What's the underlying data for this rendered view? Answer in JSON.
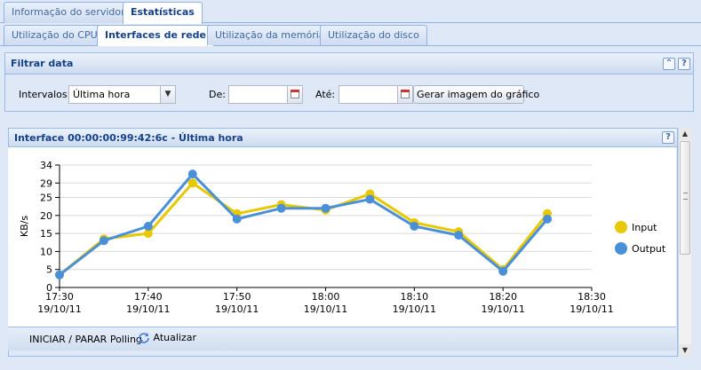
{
  "tabs": [
    {
      "label": "Informação do servidor",
      "active": false
    },
    {
      "label": "Estatísticas",
      "active": true
    }
  ],
  "subtabs": [
    {
      "label": "Utilização do CPU",
      "active": false
    },
    {
      "label": "Interfaces de rede",
      "active": true
    },
    {
      "label": "Utilização da memória",
      "active": false
    },
    {
      "label": "Utilização do disco",
      "active": false
    }
  ],
  "filter": {
    "title": "Filtrar data",
    "collapse_icon": "double-chevron-up-icon",
    "help_icon": "question-icon",
    "interval_label": "Intervalos:",
    "interval_value": "Última hora",
    "from_label": "De:",
    "from_value": "",
    "to_label": "Até:",
    "to_value": "",
    "generate_button": "Gerar imagem do gráfico"
  },
  "graph_panel": {
    "title": "Interface 00:00:00:99:42:6c - Última hora",
    "help_icon": "question-icon"
  },
  "toolbar": {
    "polling_label": "INICIAR / PARAR Polling",
    "refresh_label": "Atualizar",
    "refresh_icon": "refresh-icon"
  },
  "chart_data": {
    "type": "line",
    "ylabel": "KB/s",
    "xlabel": "",
    "ylim": [
      0,
      34
    ],
    "yticks": [
      0,
      5,
      10,
      15,
      20,
      25,
      29,
      34
    ],
    "xticks": [
      {
        "time": "17:30",
        "date": "19/10/11"
      },
      {
        "time": "17:40",
        "date": "19/10/11"
      },
      {
        "time": "17:50",
        "date": "19/10/11"
      },
      {
        "time": "18:00",
        "date": "19/10/11"
      },
      {
        "time": "18:10",
        "date": "19/10/11"
      },
      {
        "time": "18:20",
        "date": "19/10/11"
      },
      {
        "time": "18:30",
        "date": "19/10/11"
      }
    ],
    "x_minutes": [
      0,
      5,
      10,
      15,
      20,
      25,
      30,
      35,
      40,
      45,
      50,
      55,
      60
    ],
    "series": [
      {
        "name": "Input",
        "color": "#e8c800",
        "values": [
          3.5,
          13.5,
          15,
          29,
          20.5,
          23,
          21.5,
          26,
          18,
          15.5,
          5,
          20.5
        ]
      },
      {
        "name": "Output",
        "color": "#4a90d9",
        "values": [
          3.5,
          13,
          17,
          31.5,
          19,
          22,
          22,
          24.5,
          17,
          14.5,
          4.5,
          19
        ]
      }
    ],
    "legend_position": "right",
    "grid": true
  },
  "scrollbar": {
    "up_icon": "arrow-up-icon",
    "down_icon": "arrow-down-icon"
  }
}
